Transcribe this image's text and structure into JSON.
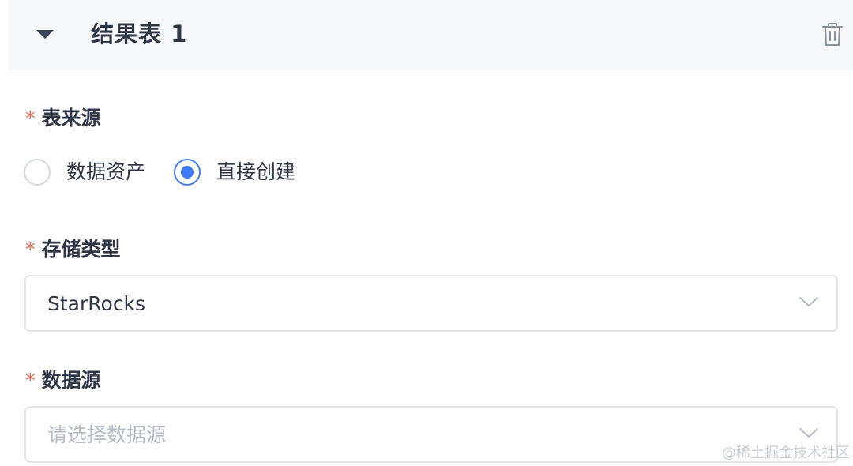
{
  "header": {
    "title": "结果表 1",
    "collapse_icon": "caret-down-icon",
    "delete_icon": "trash-icon"
  },
  "form": {
    "table_source": {
      "required_mark": "*",
      "label": "表来源",
      "options": [
        {
          "label": "数据资产",
          "checked": false
        },
        {
          "label": "直接创建",
          "checked": true
        }
      ]
    },
    "storage_type": {
      "required_mark": "*",
      "label": "存储类型",
      "value": "StarRocks"
    },
    "data_source": {
      "required_mark": "*",
      "label": "数据源",
      "placeholder": "请选择数据源"
    }
  },
  "watermark": "@稀土掘金技术社区",
  "colors": {
    "accent": "#3d7cf5",
    "required": "#e86a4f",
    "text": "#2f3648",
    "placeholder": "#b4b9c3",
    "header_bg": "#f7f8fa"
  }
}
